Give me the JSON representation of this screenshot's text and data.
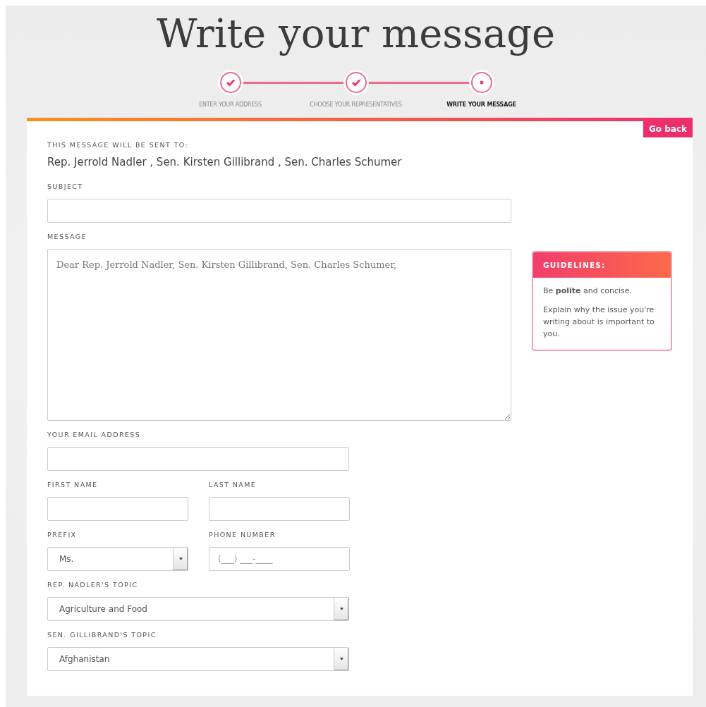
{
  "title": "Write your message",
  "steps": [
    {
      "label": "ENTER YOUR ADDRESS",
      "completed": true,
      "selected": false
    },
    {
      "label": "CHOOSE YOUR REPRESENTATIVES",
      "completed": true,
      "selected": false
    },
    {
      "label": "WRITE YOUR MESSAGE",
      "completed": false,
      "selected": true
    }
  ],
  "card": {
    "go_back": "Go back",
    "recipients_label": "THIS MESSAGE WILL BE SENT TO:",
    "recipients": "Rep. Jerrold Nadler , Sen. Kirsten Gillibrand , Sen. Charles Schumer",
    "subject": {
      "label": "SUBJECT"
    },
    "message": {
      "label": "MESSAGE",
      "value": "Dear Rep. Jerrold Nadler, Sen. Kirsten Gillibrand, Sen. Charles Schumer,"
    },
    "guidelines": {
      "title": "GUIDELINES:",
      "items": [
        "Be **polite** and concise.",
        "Explain why the issue you're writing about is important to you."
      ]
    },
    "contact_rows": [
      [
        {
          "label": "YOUR EMAIL ADDRESS",
          "kind": "text"
        }
      ],
      [
        {
          "label": "FIRST NAME",
          "kind": "text"
        },
        {
          "label": "LAST NAME",
          "kind": "text"
        }
      ],
      [
        {
          "label": "PREFIX",
          "kind": "select",
          "value": "Ms."
        },
        {
          "label": "PHONE NUMBER",
          "kind": "text",
          "placeholder": "(___) ___-____"
        }
      ],
      [
        {
          "label": "REP. NADLER'S TOPIC",
          "kind": "select",
          "value": "Agriculture and Food"
        }
      ],
      [
        {
          "label": "SEN. GILLIBRAND'S TOPIC",
          "kind": "select",
          "value": "Afghanistan"
        }
      ]
    ]
  }
}
